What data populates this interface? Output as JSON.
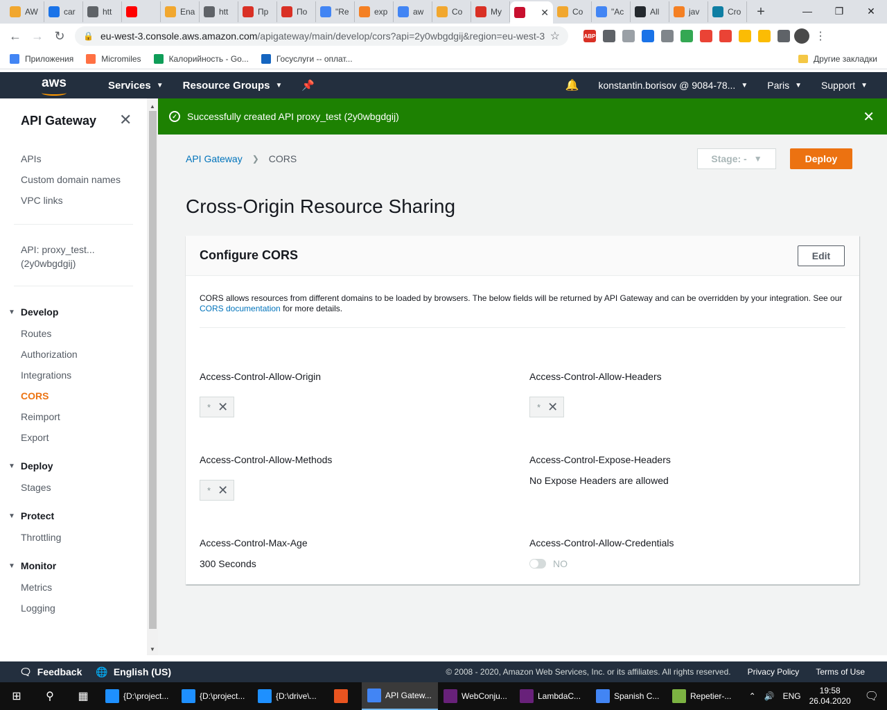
{
  "browser": {
    "tabs": [
      {
        "label": "AW",
        "color": "#f1a72f"
      },
      {
        "label": "car",
        "color": "#1a73e8"
      },
      {
        "label": "htt",
        "color": "#5f6368"
      },
      {
        "label": "",
        "color": "#ff0000"
      },
      {
        "label": "Ena",
        "color": "#f1a72f"
      },
      {
        "label": "htt",
        "color": "#5f6368"
      },
      {
        "label": "Пр",
        "color": "#d93025"
      },
      {
        "label": "По",
        "color": "#d93025"
      },
      {
        "label": "\"Re",
        "color": "#4285f4"
      },
      {
        "label": "exp",
        "color": "#f48024"
      },
      {
        "label": "aw",
        "color": "#4285f4"
      },
      {
        "label": "Co",
        "color": "#f1a72f"
      },
      {
        "label": "My",
        "color": "#d93025"
      },
      {
        "label": "",
        "color": "#c8102e"
      },
      {
        "label": "Co",
        "color": "#f1a72f"
      },
      {
        "label": "\"Ac",
        "color": "#4285f4"
      },
      {
        "label": "All",
        "color": "#24292e"
      },
      {
        "label": "jav",
        "color": "#f48024"
      },
      {
        "label": "Cro",
        "color": "#0e7ea3"
      }
    ],
    "url_host": "eu-west-3.console.aws.amazon.com",
    "url_path": "/apigateway/main/develop/cors?api=2y0wbgdgij&region=eu-west-3",
    "bookmarks": [
      {
        "label": "Приложения",
        "color": "#4285f4"
      },
      {
        "label": "Micromiles",
        "color": "#ff7043"
      },
      {
        "label": "Калорийность - Go...",
        "color": "#0f9d58"
      },
      {
        "label": "Госуслуги -- оплат...",
        "color": "#1565c0"
      }
    ],
    "other_bookmarks": "Другие закладки"
  },
  "awsnav": {
    "services": "Services",
    "resource_groups": "Resource Groups",
    "account": "konstantin.borisov @ 9084-78...",
    "region": "Paris",
    "support": "Support"
  },
  "sidebar": {
    "title": "API Gateway",
    "top_links": [
      "APIs",
      "Custom domain names",
      "VPC links"
    ],
    "api_name": "API: proxy_test... (2y0wbgdgij)",
    "sections": {
      "develop": {
        "title": "Develop",
        "items": [
          "Routes",
          "Authorization",
          "Integrations",
          "CORS",
          "Reimport",
          "Export"
        ]
      },
      "deploy": {
        "title": "Deploy",
        "items": [
          "Stages"
        ]
      },
      "protect": {
        "title": "Protect",
        "items": [
          "Throttling"
        ]
      },
      "monitor": {
        "title": "Monitor",
        "items": [
          "Metrics",
          "Logging"
        ]
      }
    }
  },
  "flash": {
    "message": "Successfully created API proxy_test (2y0wbgdgij)"
  },
  "breadcrumb": {
    "root": "API Gateway",
    "current": "CORS"
  },
  "stage_select": "Stage: -",
  "deploy_label": "Deploy",
  "page_title": "Cross-Origin Resource Sharing",
  "card": {
    "title": "Configure CORS",
    "edit_label": "Edit",
    "desc_before": "CORS allows resources from different domains to be loaded by browsers. The below fields will be returned by API Gateway and can be overridden by your integration. See our ",
    "desc_link": "CORS documentation",
    "desc_after": " for more details.",
    "fields": {
      "allow_origin": {
        "label": "Access-Control-Allow-Origin",
        "token": "*"
      },
      "allow_headers": {
        "label": "Access-Control-Allow-Headers",
        "token": "*"
      },
      "allow_methods": {
        "label": "Access-Control-Allow-Methods",
        "token": "*"
      },
      "expose_headers": {
        "label": "Access-Control-Expose-Headers",
        "value": "No Expose Headers are allowed"
      },
      "max_age": {
        "label": "Access-Control-Max-Age",
        "value": "300 Seconds"
      },
      "allow_credentials": {
        "label": "Access-Control-Allow-Credentials",
        "value": "NO"
      }
    }
  },
  "footer": {
    "feedback": "Feedback",
    "language": "English (US)",
    "copyright": "© 2008 - 2020, Amazon Web Services, Inc. or its affiliates. All rights reserved.",
    "privacy": "Privacy Policy",
    "terms": "Terms of Use"
  },
  "taskbar": {
    "apps": [
      {
        "label": "{D:\\project...",
        "color": "#1e90ff"
      },
      {
        "label": "{D:\\project...",
        "color": "#1e90ff"
      },
      {
        "label": "{D:\\drive\\...",
        "color": "#1e90ff"
      },
      {
        "label": "",
        "color": "#e95420"
      },
      {
        "label": "API Gatew...",
        "color": "#4285f4"
      },
      {
        "label": "WebConju...",
        "color": "#68217a"
      },
      {
        "label": "LambdaC...",
        "color": "#68217a"
      },
      {
        "label": "Spanish C...",
        "color": "#4285f4"
      },
      {
        "label": "Repetier-...",
        "color": "#7cb342"
      }
    ],
    "lang": "ENG",
    "time": "19:58",
    "date": "26.04.2020"
  }
}
